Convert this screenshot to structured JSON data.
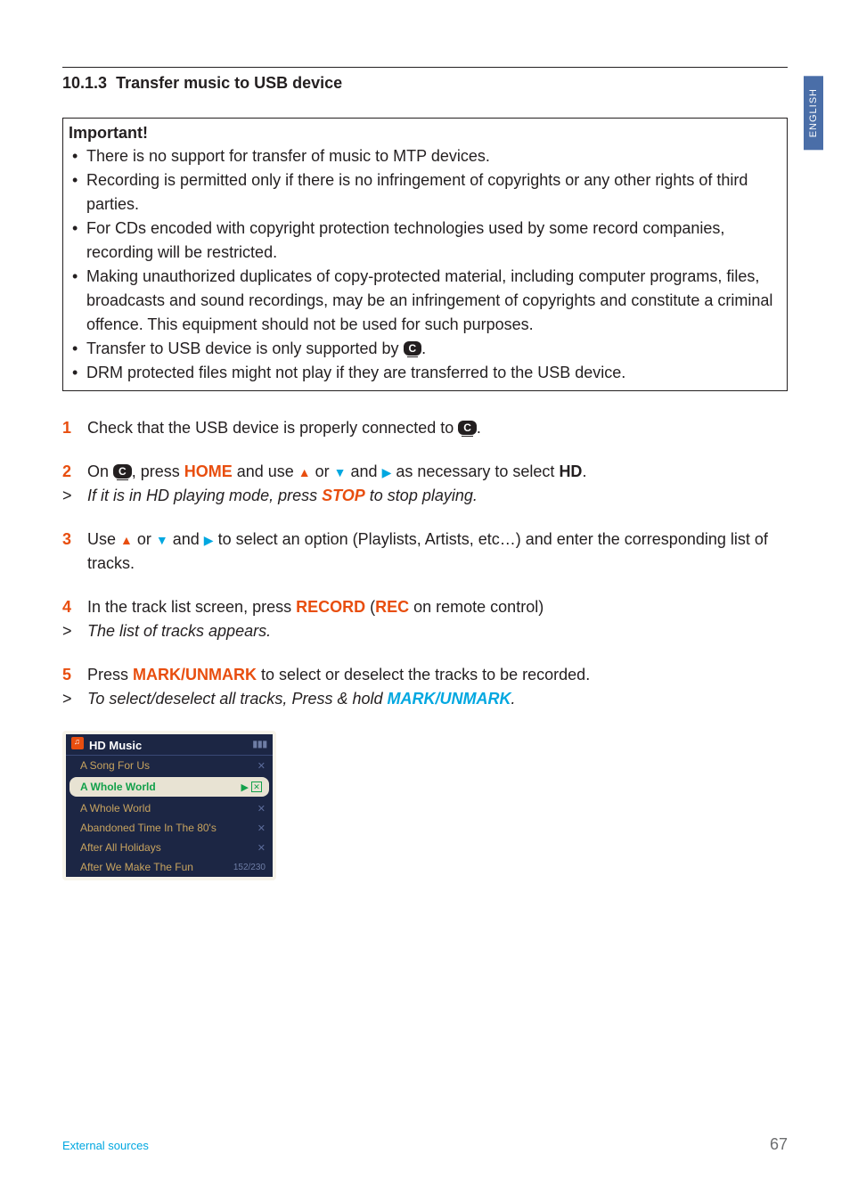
{
  "sideTab": "ENGLISH",
  "sectionNumber": "10.1.3",
  "sectionTitle": "Transfer music to USB device",
  "important": {
    "title": "Important!",
    "items": [
      "There is no support for transfer of music to MTP devices.",
      "Recording is permitted only if there is no infringement of copyrights or any other rights of third parties.",
      "For CDs encoded with copyright protection technologies used by some record companies, recording will be restricted.",
      "Making unauthorized duplicates of copy-protected material, including computer programs, files, broadcasts and sound recordings, may be an infringement of copyrights and constitute a criminal offence. This equipment should not be used for such purposes.",
      "__TRANSFER_USB__",
      "DRM protected files might not play if they are transferred to the USB device."
    ],
    "transferPrefix": "Transfer to USB device is only supported by "
  },
  "steps": {
    "s1_prefix": "Check that the USB device is properly connected to ",
    "s2_prefix": "On ",
    "s2_press": ", press ",
    "s2_home": "HOME",
    "s2_anduse": " and use ",
    "s2_or": " or ",
    "s2_and": " and ",
    "s2_suffix": " as necessary to select ",
    "s2_hd": "HD",
    "s2_sub_prefix": "If it is in HD playing mode, press ",
    "s2_stop": "STOP",
    "s2_sub_suffix": " to stop playing.",
    "s3_prefix": "Use ",
    "s3_suffix": " to select an option (Playlists,  Artists, etc…) and enter the corresponding list of tracks.",
    "s4_prefix": "In the track list screen, press ",
    "s4_record": "RECORD",
    "s4_mid": " (",
    "s4_rec": "REC",
    "s4_suffix": " on remote control)",
    "s4_sub": "The list of tracks appears.",
    "s5_prefix": "Press ",
    "s5_mark": "MARK/UNMARK",
    "s5_suffix": " to select or deselect the tracks to be recorded.",
    "s5_sub_prefix": "To select/deselect all tracks, Press & hold ",
    "s5_sub_mark": "MARK/UNMARK"
  },
  "device": {
    "header": "HD Music",
    "tracks": [
      "A Song For Us",
      "A Whole World",
      "A Whole World",
      "Abandoned Time In The 80's",
      "After All Holidays",
      "After We Make The Fun"
    ],
    "selectedIndex": 1,
    "counter": "152/230"
  },
  "footer": {
    "left": "External sources",
    "page": "67"
  },
  "iconLabel": "C"
}
